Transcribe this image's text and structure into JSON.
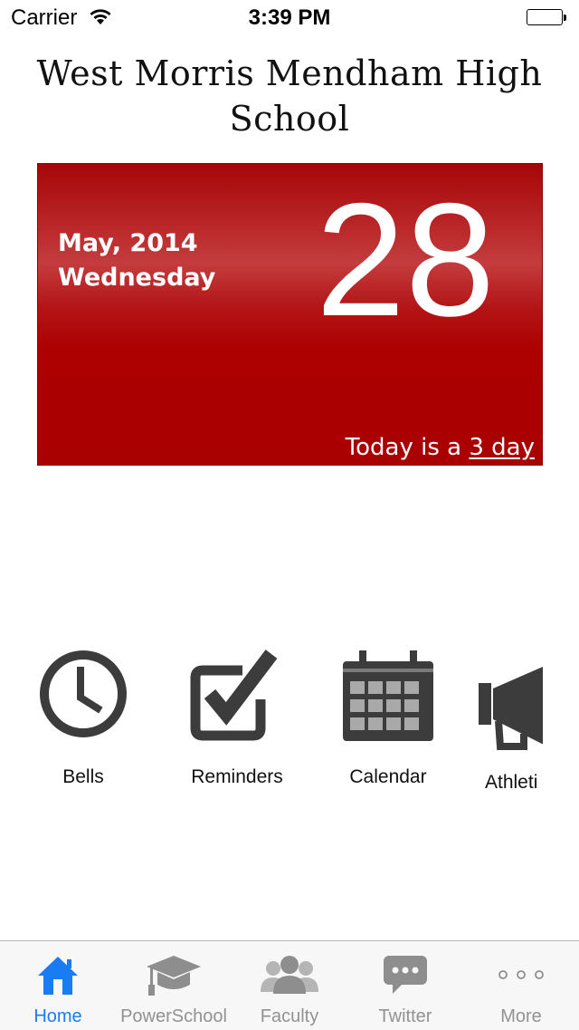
{
  "status_bar": {
    "carrier": "Carrier",
    "time": "3:39 PM",
    "icons": [
      "wifi-icon",
      "battery-icon"
    ]
  },
  "header": {
    "title": "West Morris Mendham High School"
  },
  "date_card": {
    "month_year": "May, 2014",
    "weekday": "Wednesday",
    "day": "28",
    "today_prefix": "Today is a",
    "day_type": "3 day",
    "color": "#ae0001"
  },
  "shortcuts": [
    {
      "label": "Bells",
      "icon": "clock-icon"
    },
    {
      "label": "Reminders",
      "icon": "checkbox-icon"
    },
    {
      "label": "Calendar",
      "icon": "calendar-icon"
    },
    {
      "label": "Athleti",
      "icon": "megaphone-icon"
    }
  ],
  "tab_bar": {
    "active_color": "#1a7cf2",
    "inactive_color": "#929292",
    "tabs": [
      {
        "label": "Home",
        "icon": "home-icon",
        "active": true
      },
      {
        "label": "PowerSchool",
        "icon": "graduation-cap-icon",
        "active": false
      },
      {
        "label": "Faculty",
        "icon": "people-icon",
        "active": false
      },
      {
        "label": "Twitter",
        "icon": "speech-bubble-icon",
        "active": false
      },
      {
        "label": "More",
        "icon": "more-dots-icon",
        "active": false
      }
    ]
  }
}
